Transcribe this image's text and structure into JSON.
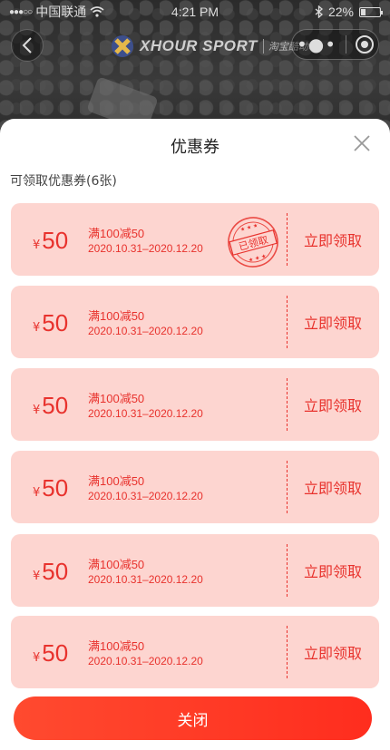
{
  "status_bar": {
    "carrier": "中国联通",
    "time": "4:21 PM",
    "battery": "22%"
  },
  "nav": {
    "brand": "XHOUR SPORT",
    "brand_sub": "淘宝酷动城"
  },
  "sheet": {
    "title": "优惠券",
    "subtitle": "可领取优惠券(6张)"
  },
  "coupons": [
    {
      "currency": "¥",
      "amount": "50",
      "condition": "满100减50",
      "date": "2020.10.31–2020.12.20",
      "action": "立即领取",
      "claimed": true,
      "stamp": "已领取"
    },
    {
      "currency": "¥",
      "amount": "50",
      "condition": "满100减50",
      "date": "2020.10.31–2020.12.20",
      "action": "立即领取",
      "claimed": false
    },
    {
      "currency": "¥",
      "amount": "50",
      "condition": "满100减50",
      "date": "2020.10.31–2020.12.20",
      "action": "立即领取",
      "claimed": false
    },
    {
      "currency": "¥",
      "amount": "50",
      "condition": "满100减50",
      "date": "2020.10.31–2020.12.20",
      "action": "立即领取",
      "claimed": false
    },
    {
      "currency": "¥",
      "amount": "50",
      "condition": "满100减50",
      "date": "2020.10.31–2020.12.20",
      "action": "立即领取",
      "claimed": false
    },
    {
      "currency": "¥",
      "amount": "50",
      "condition": "满100减50",
      "date": "2020.10.31–2020.12.20",
      "action": "立即领取",
      "claimed": false
    }
  ],
  "footer": {
    "close_label": "关闭"
  },
  "colors": {
    "accent": "#e8322d",
    "coupon_bg": "#fdd5d0",
    "button": "#ff3a24"
  },
  "icons": [
    "wifi-icon",
    "bluetooth-icon",
    "battery-icon",
    "back-icon",
    "more-icon",
    "target-icon",
    "close-icon",
    "claimed-stamp"
  ]
}
